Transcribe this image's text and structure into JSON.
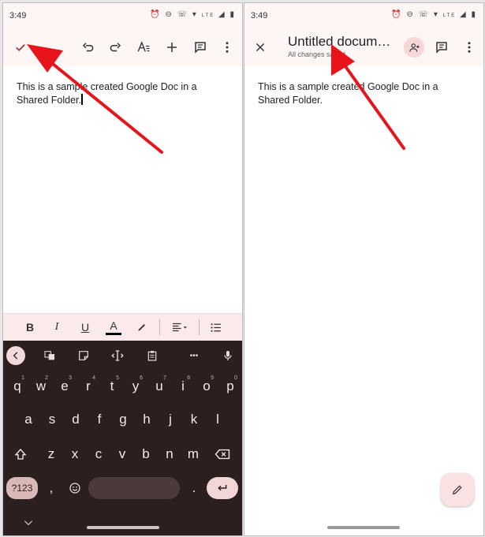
{
  "left": {
    "status": {
      "time": "3:49",
      "network": "LTE"
    },
    "doc_text": "This is a sample created Google Doc in a Shared Folder.",
    "format_bar": {
      "bold": "B",
      "italic": "I",
      "underline": "U",
      "text_color": "A"
    },
    "keyboard": {
      "row1": [
        "q",
        "w",
        "e",
        "r",
        "t",
        "y",
        "u",
        "i",
        "o",
        "p"
      ],
      "row1_hints": [
        "1",
        "2",
        "3",
        "4",
        "5",
        "6",
        "7",
        "8",
        "9",
        "0"
      ],
      "row2": [
        "a",
        "s",
        "d",
        "f",
        "g",
        "h",
        "j",
        "k",
        "l"
      ],
      "row3": [
        "z",
        "x",
        "c",
        "v",
        "b",
        "n",
        "m"
      ],
      "symbols_label": "?123",
      "comma": ",",
      "period": ".",
      "suggestion_more": "•••"
    }
  },
  "right": {
    "status": {
      "time": "3:49",
      "network": "LTE"
    },
    "title": "Untitled docum…",
    "subtitle": "All changes saved",
    "doc_text": "This is a sample created Google Doc in a Shared Folder."
  },
  "colors": {
    "annotation_arrow": "#e8141b",
    "accent": "#9c3b3b",
    "toolbar_bg": "#fdf6f5",
    "keyboard_bg": "#2b1f1f"
  }
}
